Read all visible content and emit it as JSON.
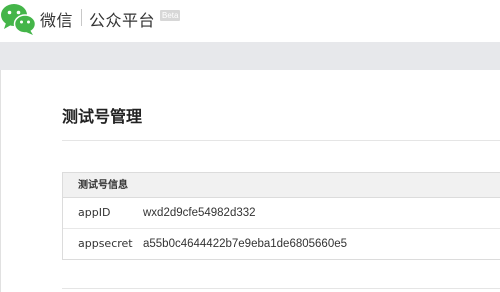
{
  "header": {
    "brand": "微信",
    "platform": "公众平台",
    "badge": "Beta",
    "logo_icon": "wechat-logo-icon",
    "accent_color": "#44b549"
  },
  "page": {
    "title": "测试号管理"
  },
  "panel": {
    "heading": "测试号信息",
    "rows": [
      {
        "label": "appID",
        "value": "wxd2d9cfe54982d332"
      },
      {
        "label": "appsecret",
        "value": "a55b0c4644422b7e9eba1de6805660e5"
      }
    ]
  }
}
